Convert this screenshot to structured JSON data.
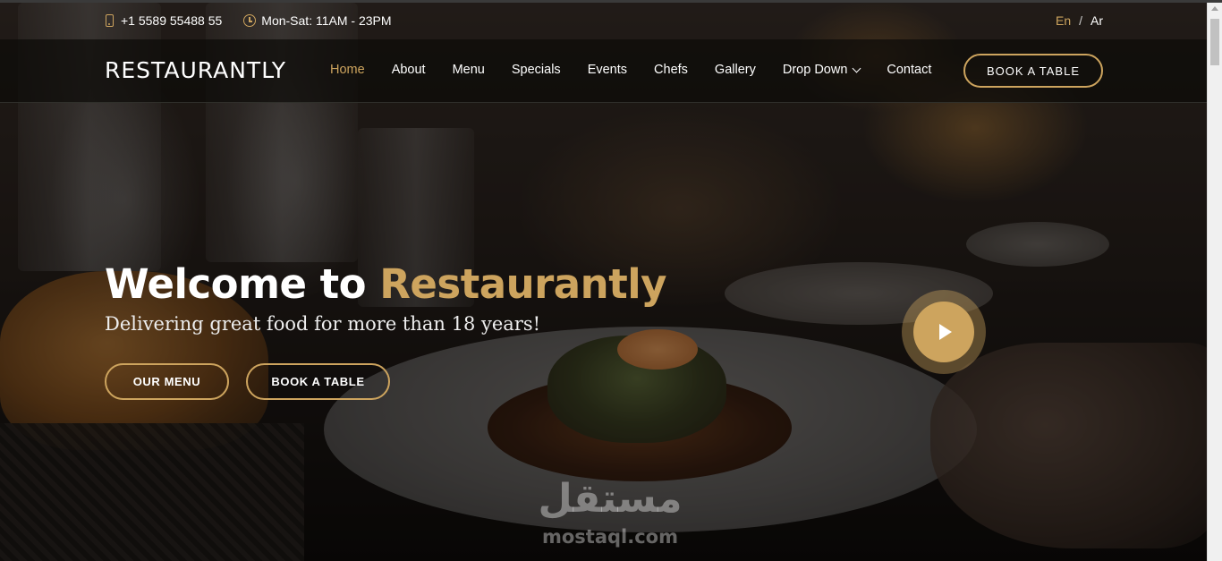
{
  "topbar": {
    "phone": "+1 5589 55488 55",
    "hours": "Mon-Sat: 11AM - 23PM",
    "lang_en": "En",
    "lang_sep": "/",
    "lang_ar": "Ar"
  },
  "header": {
    "logo": "RESTAURANTLY",
    "nav": [
      {
        "label": "Home",
        "active": true
      },
      {
        "label": "About"
      },
      {
        "label": "Menu"
      },
      {
        "label": "Specials"
      },
      {
        "label": "Events"
      },
      {
        "label": "Chefs"
      },
      {
        "label": "Gallery"
      },
      {
        "label": "Drop Down",
        "has_dropdown": true
      },
      {
        "label": "Contact"
      }
    ],
    "book_button": "BOOK A TABLE"
  },
  "hero": {
    "title_prefix": "Welcome to",
    "title_brand": "Restaurantly",
    "subtitle": "Delivering great food for more than 18 years!",
    "menu_button": "OUR MENU",
    "book_button": "BOOK A TABLE"
  },
  "watermark": {
    "arabic": "مستقل",
    "latin": "mostaql.com"
  },
  "colors": {
    "accent": "#cda45e",
    "header_bg": "#0c0b09"
  },
  "icons": {
    "phone": "phone-icon",
    "clock": "clock-icon",
    "play": "play-icon",
    "chevron": "chevron-down-icon"
  }
}
